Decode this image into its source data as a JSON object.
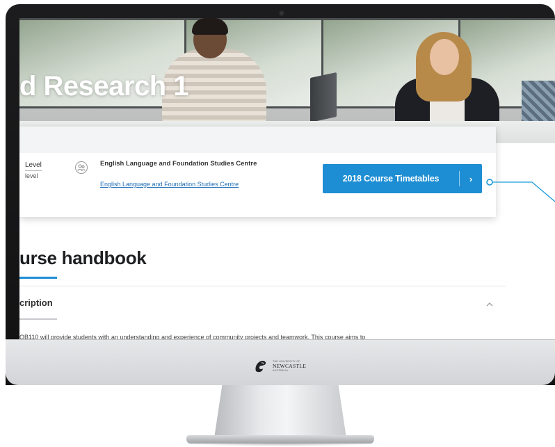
{
  "hero": {
    "title": "d Research 1"
  },
  "course_info": {
    "level_heading": "Level",
    "level_value": "level",
    "school_name": "English Language and Foundation Studies Centre",
    "school_link": "English Language and Foundation Studies Centre",
    "school_icon": "people-icon"
  },
  "timetable_button": {
    "label": "2018 Course Timetables",
    "chevron": "›"
  },
  "handbook": {
    "title": "urse handbook",
    "description_heading": "cription",
    "collapse_icon": "^",
    "description_text": "OB110 will provide students with an understanding and experience of community projects and teamwork. This course aims to"
  },
  "brand": {
    "small_top": "THE UNIVERSITY OF",
    "name": "NEWCASTLE",
    "small_bottom": "AUSTRALIA"
  },
  "colors": {
    "accent": "#1d8ed4",
    "callout_line": "#1a9ad6"
  }
}
